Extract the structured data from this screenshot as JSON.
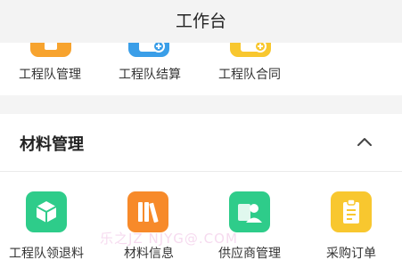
{
  "header": {
    "title": "工作台"
  },
  "team_section": {
    "items": [
      {
        "label": "工程队管理",
        "icon": "team-management-icon",
        "color": "#f7a32e"
      },
      {
        "label": "工程队结算",
        "icon": "team-settlement-icon",
        "color": "#3a9ee8"
      },
      {
        "label": "工程队合同",
        "icon": "team-contract-icon",
        "color": "#f8c72f"
      }
    ]
  },
  "materials_section": {
    "title": "材料管理",
    "collapse_icon": "chevron-up-icon",
    "items": [
      {
        "label": "工程队领退料",
        "icon": "material-pickup-return-icon",
        "color": "#2ecc8a"
      },
      {
        "label": "材料信息",
        "icon": "material-info-icon",
        "color": "#f78a2a"
      },
      {
        "label": "供应商管理",
        "icon": "supplier-management-icon",
        "color": "#2ecc8a"
      },
      {
        "label": "采购订单",
        "icon": "purchase-order-icon",
        "color": "#f8c72f"
      }
    ]
  },
  "watermark": "乐之JZ NJYG@.COM"
}
